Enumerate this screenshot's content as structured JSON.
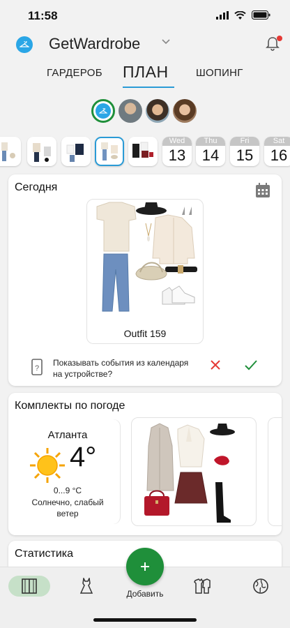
{
  "status_bar": {
    "time": "11:58"
  },
  "header": {
    "app_title": "GetWardrobe"
  },
  "tabs": [
    {
      "label": "ГАРДЕРОБ"
    },
    {
      "label": "ПЛАН"
    },
    {
      "label": "ШОПИНГ"
    }
  ],
  "date_strip": {
    "days": [
      {
        "dow": "Wed",
        "num": "13"
      },
      {
        "dow": "Thu",
        "num": "14"
      },
      {
        "dow": "Fri",
        "num": "15"
      },
      {
        "dow": "Sat",
        "num": "16"
      }
    ]
  },
  "today": {
    "title": "Сегодня",
    "outfit_label": "Outfit 159",
    "calendar_question": "Показывать события из календаря на устройстве?"
  },
  "weather": {
    "title": "Комплекты по погоде",
    "city": "Атланта",
    "temperature": "4°",
    "range": "0...9 °C",
    "condition": "Солнечно, слабый ветер"
  },
  "stats": {
    "title": "Статистика"
  },
  "bottom_nav": {
    "add_label": "Добавить"
  },
  "colors": {
    "accent_blue": "#2a9bd6",
    "green": "#1f8f3a",
    "red": "#e53935",
    "active_nav_bg": "#c6e0c8"
  }
}
